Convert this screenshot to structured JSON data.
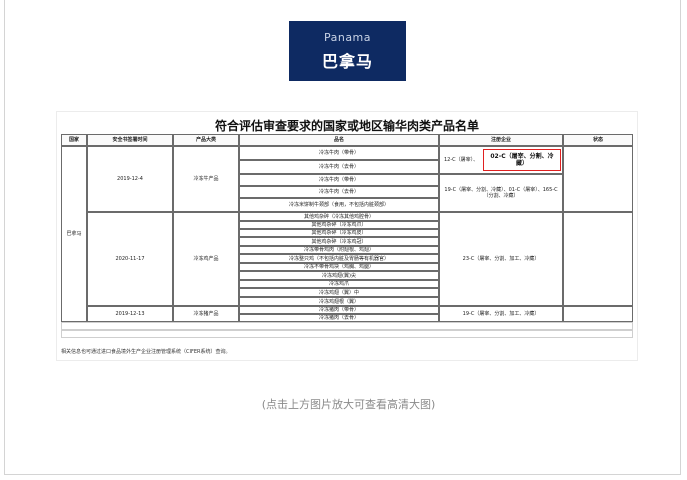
{
  "badge": {
    "country_en": "Panama",
    "country_cn": "巴拿马"
  },
  "document": {
    "title": "符合评估审查要求的国家或地区输华肉类产品名单",
    "headers": [
      "国家",
      "安全书签署时间",
      "产品大类",
      "品名",
      "注册企业",
      "状态"
    ],
    "country": "巴拿马",
    "groups": [
      {
        "date": "2019-12-4",
        "category": "冷冻牛产品",
        "products": [
          "冷冻牛肉（带骨）",
          "冷冻牛肉（去骨）",
          "冷冻牛肉（带骨）",
          "冷冻牛肉（去骨）",
          "冷冻米饼制牛颈部（食用，不包括内脏颈部）"
        ],
        "enterprise_a": "12-C（屠宰）、",
        "enterprise_a_highlight": "02-C（屠宰、分割、冷藏）",
        "enterprise_b": "19-C（屠宰、分割、冷藏）、01-C（屠宰）、165-C（分割、冷藏）"
      },
      {
        "date": "2020-11-17",
        "category": "冷冻鸡产品",
        "products": [
          "其他鸡杂碎（冷冻其他鸡腔骨）",
          "其他鸡杂碎（冷冻鸡爪）",
          "其他鸡杂碎（冷冻鸡皮）",
          "其他鸡杂碎（冷冻鸡冠）",
          "冷冻带骨鸡肉（附翅根、鸡翅）",
          "冷冻整只鸡（不包括内脏及胃肠等有机器官）",
          "冷冻不带骨鸡块（鸡胸、鸡腿）",
          "冷冻鸡翅(翼)尖",
          "冷冻鸡爪",
          "冷冻鸡翅（翼）中",
          "冷冻鸡翅根（翼）"
        ],
        "enterprise": "23-C（屠宰、分割、加工、冷藏）"
      },
      {
        "date": "2019-12-13",
        "category": "冷冻猪产品",
        "products": [
          "冷冻猪肉（带骨）",
          "冷冻猪肉（去骨）"
        ],
        "enterprise": "19-C（屠宰、分割、加工、冷藏）"
      }
    ],
    "footnote": "相关信息也可通过进口食品境外生产企业注册管理系统（CIFER系统）查询。"
  },
  "caption": "(点击上方图片放大可查看高清大图)"
}
